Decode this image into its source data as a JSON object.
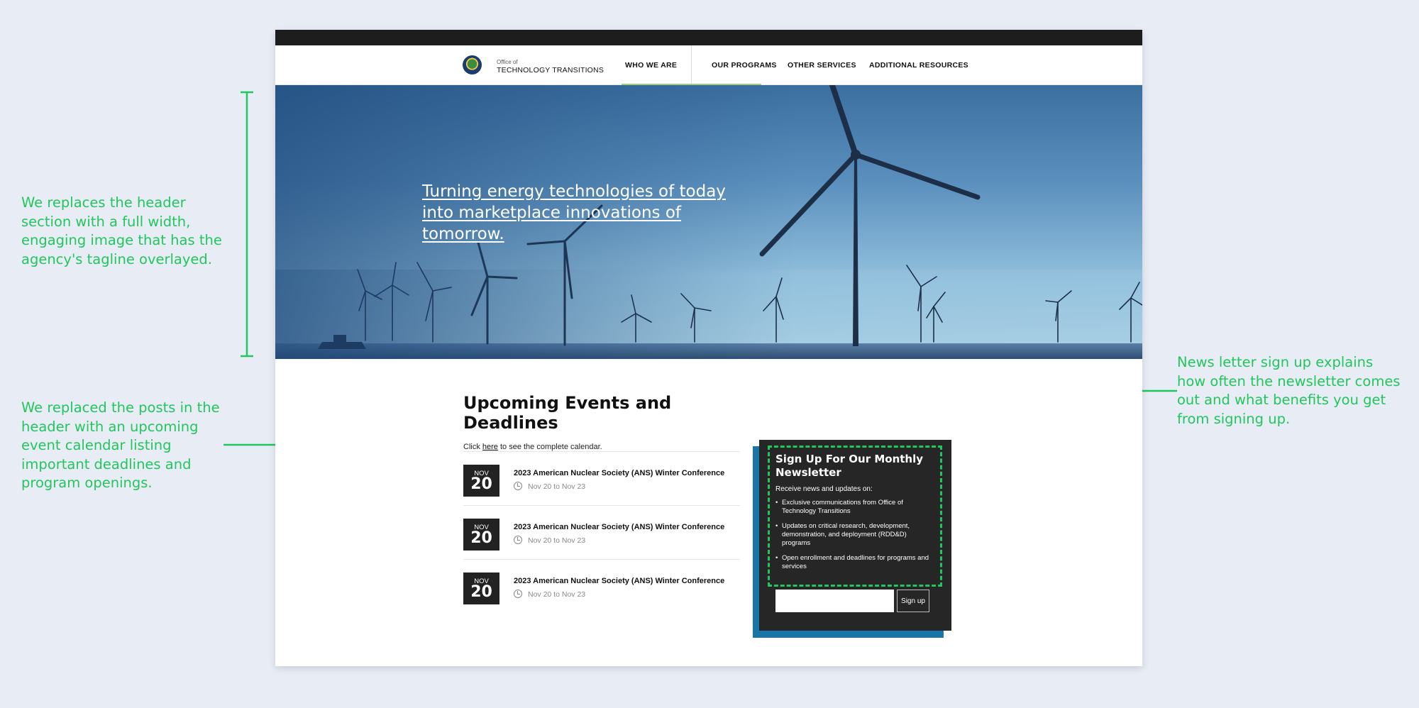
{
  "annotations": {
    "header_note": "We replaces the header section with a full width, engaging image that has the agency's tagline overlayed.",
    "events_note": "We replaced the posts in the header with an upcoming event calendar listing important deadlines and program openings.",
    "newsletter_note": "News letter sign up explains how often the newsletter comes out and what benefits you get from signing up.",
    "color": "#22c55e"
  },
  "site": {
    "brand_small": "Office of",
    "brand_name": "TECHNOLOGY TRANSITIONS",
    "nav": [
      "WHO WE ARE",
      "OUR PROGRAMS",
      "OTHER SERVICES",
      "ADDITIONAL RESOURCES"
    ],
    "hero": {
      "tagline": "Turning energy technologies of today into marketplace innovations of tomorrow."
    },
    "events": {
      "title": "Upcoming Events and Deadlines",
      "sub_prefix": "Click ",
      "sub_link": "here",
      "sub_suffix": " to see the complete calendar.",
      "items": [
        {
          "month": "NOV",
          "day": "20",
          "title": "2023 American Nuclear Society (ANS) Winter Conference",
          "dates": "Nov 20 to Nov 23"
        },
        {
          "month": "NOV",
          "day": "20",
          "title": "2023 American Nuclear Society (ANS) Winter Conference",
          "dates": "Nov 20 to Nov 23"
        },
        {
          "month": "NOV",
          "day": "20",
          "title": "2023 American Nuclear Society (ANS) Winter Conference",
          "dates": "Nov 20 to Nov 23"
        }
      ]
    },
    "newsletter": {
      "title": "Sign Up For Our Monthly Newsletter",
      "intro": "Receive news and updates on:",
      "bullets": [
        "Exclusive communications from Office of Technology Transitions",
        "Updates on critical research, development, demonstration, and deployment (RDD&D) programs",
        "Open enrollment and deadlines for programs and services"
      ],
      "button": "Sign up",
      "email_value": ""
    },
    "colors": {
      "accent_green": "#9ad07e",
      "newsletter_shadow": "#1976a7",
      "dark": "#262626"
    }
  }
}
